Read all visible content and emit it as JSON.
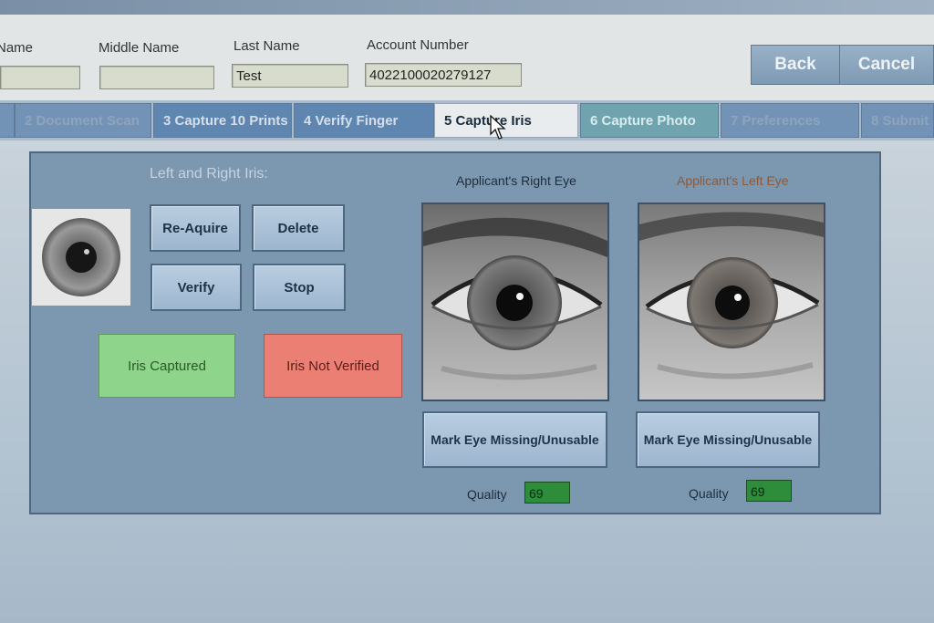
{
  "header": {
    "first_name_label": "Name",
    "middle_name_label": "Middle Name",
    "last_name_label": "Last Name",
    "last_name_value": "Test",
    "account_number_label": "Account Number",
    "account_number_value": "4022100020279127",
    "back_label": "Back",
    "cancel_label": "Cancel"
  },
  "tabs": [
    {
      "label": "2 Document Scan"
    },
    {
      "label": "3 Capture 10 Prints"
    },
    {
      "label": "4 Verify Finger"
    },
    {
      "label": "5 Capture Iris"
    },
    {
      "label": "6 Capture Photo"
    },
    {
      "label": "7 Preferences"
    },
    {
      "label": "8 Submit"
    }
  ],
  "panel": {
    "title": "Left and Right Iris:",
    "reacquire_label": "Re-Aquire",
    "delete_label": "Delete",
    "verify_label": "Verify",
    "stop_label": "Stop",
    "status_captured": "Iris Captured",
    "status_not_verified": "Iris Not Verified",
    "right_eye_caption": "Applicant's Right Eye",
    "left_eye_caption": "Applicant's Left Eye",
    "mark_right_label": "Mark Eye Missing/Unusable",
    "mark_left_label": "Mark Eye Missing/Unusable",
    "quality_label": "Quality",
    "right_quality": "69",
    "left_quality": "69"
  },
  "colors": {
    "captured": "#8fd48b",
    "not_verified": "#ec7f74",
    "quality_bg": "#2e8d3a",
    "left_caption": "#8a5a3c",
    "right_caption": "#1d2d3c"
  },
  "icons": {
    "iris_thumbnail": "iris-icon",
    "cursor": "mouse-pointer-icon"
  }
}
